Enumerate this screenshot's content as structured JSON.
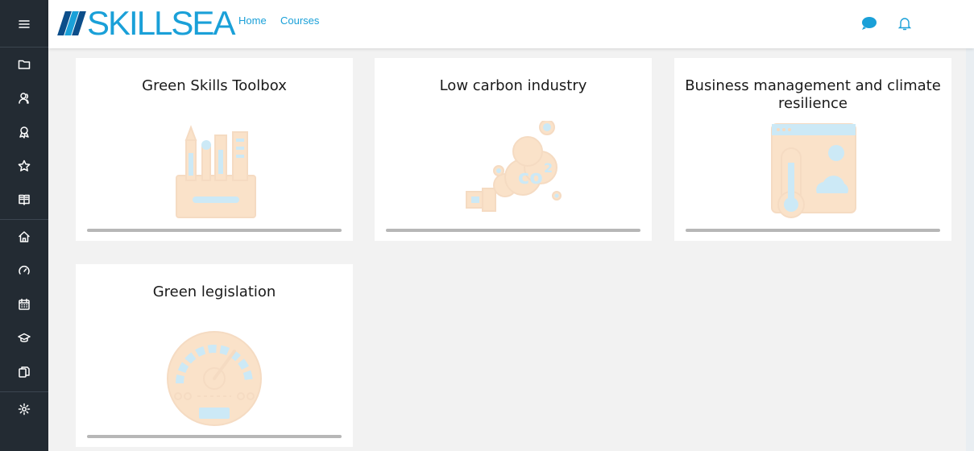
{
  "header": {
    "logo_text": "SKILLSEA",
    "nav": {
      "home": "Home",
      "courses": "Courses"
    }
  },
  "sidebar": {
    "icons": [
      "menu-icon",
      "folder-icon",
      "users-icon",
      "award-icon",
      "star-icon",
      "book-icon",
      "home-icon",
      "dashboard-icon",
      "calendar-icon",
      "graduation-cap-icon",
      "copy-icon",
      "settings-icon"
    ]
  },
  "courses": [
    {
      "title": "Green Skills Toolbox",
      "icon": "tools-illustration"
    },
    {
      "title": "Low carbon industry",
      "icon": "co2-pollution-illustration"
    },
    {
      "title": "Business management and climate resilience",
      "icon": "thermometer-weather-illustration"
    },
    {
      "title": "Green legislation",
      "icon": "gauge-meter-illustration"
    }
  ],
  "colors": {
    "accent": "#1aa0d8",
    "sidebar": "#232b33",
    "background": "#f2f2f2",
    "illustration_orange": "#f4c08a",
    "illustration_blue": "#8fd0ec"
  }
}
